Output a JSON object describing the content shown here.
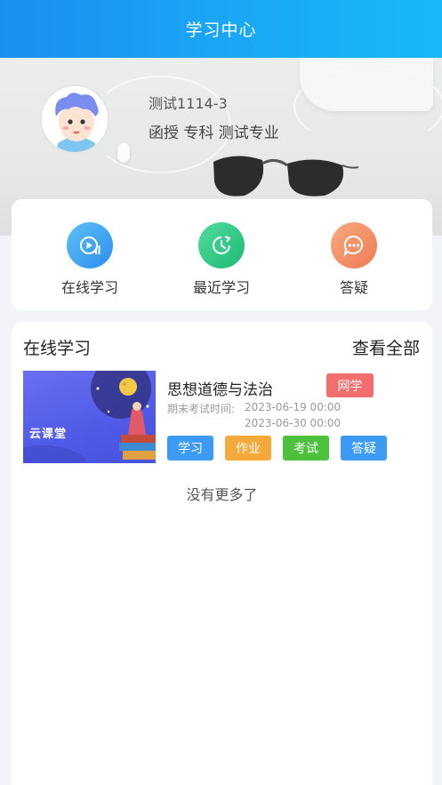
{
  "header": {
    "title": "学习中心"
  },
  "profile": {
    "name": "测试1114-3",
    "info": "函授 专科 测试专业"
  },
  "quick_actions": [
    {
      "label": "在线学习",
      "icon": "play-video-icon",
      "color": "#3aa3f0"
    },
    {
      "label": "最近学习",
      "icon": "clock-icon",
      "color": "#2fc98a"
    },
    {
      "label": "答疑",
      "icon": "chat-bubble-icon",
      "color": "#f28a64"
    }
  ],
  "courses_section": {
    "title": "在线学习",
    "view_all": "查看全部"
  },
  "course": {
    "thumbnail_text": "云课堂",
    "title": "思想道德与法治",
    "tag": "网学",
    "exam_label": "期末考试时间:",
    "exam_start": "2023-06-19 00:00",
    "exam_end": "2023-06-30 00:00",
    "actions": [
      {
        "label": "学习",
        "color": "#3d9bf5"
      },
      {
        "label": "作业",
        "color": "#f5a93b"
      },
      {
        "label": "考试",
        "color": "#4dc13d"
      },
      {
        "label": "答疑",
        "color": "#3d9bf5"
      }
    ]
  },
  "footer_text": "没有更多了"
}
